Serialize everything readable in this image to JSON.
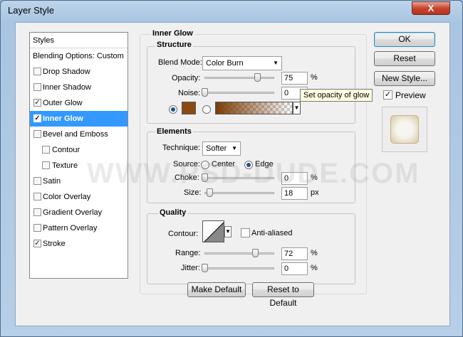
{
  "window": {
    "title": "Layer Style",
    "close_label": "X"
  },
  "styles_list": {
    "items": [
      {
        "label": "Styles",
        "checkbox": false
      },
      {
        "label": "Blending Options: Custom",
        "checkbox": false
      },
      {
        "label": "Drop Shadow",
        "checkbox": true,
        "checked": false
      },
      {
        "label": "Inner Shadow",
        "checkbox": true,
        "checked": false
      },
      {
        "label": "Outer Glow",
        "checkbox": true,
        "checked": true
      },
      {
        "label": "Inner Glow",
        "checkbox": true,
        "checked": true,
        "selected": true
      },
      {
        "label": "Bevel and Emboss",
        "checkbox": true,
        "checked": false
      },
      {
        "label": "Contour",
        "checkbox": true,
        "checked": false,
        "indent": true
      },
      {
        "label": "Texture",
        "checkbox": true,
        "checked": false,
        "indent": true
      },
      {
        "label": "Satin",
        "checkbox": true,
        "checked": false
      },
      {
        "label": "Color Overlay",
        "checkbox": true,
        "checked": false
      },
      {
        "label": "Gradient Overlay",
        "checkbox": true,
        "checked": false
      },
      {
        "label": "Pattern Overlay",
        "checkbox": true,
        "checked": false
      },
      {
        "label": "Stroke",
        "checkbox": true,
        "checked": true
      }
    ]
  },
  "inner_glow": {
    "title": "Inner Glow",
    "structure": {
      "title": "Structure",
      "blend_mode_label": "Blend Mode:",
      "blend_mode_value": "Color Burn",
      "opacity_label": "Opacity:",
      "opacity_value": "75",
      "opacity_unit": "%",
      "noise_label": "Noise:",
      "noise_value": "0",
      "noise_unit": "%",
      "color_swatch": "#8b4a10",
      "gradient_start": "#7a3d08",
      "opacity_level": 0.75,
      "noise_level": 0
    },
    "elements": {
      "title": "Elements",
      "technique_label": "Technique:",
      "technique_value": "Softer",
      "source_label": "Source:",
      "center_label": "Center",
      "edge_label": "Edge",
      "choke_label": "Choke:",
      "choke_value": "0",
      "choke_unit": "%",
      "size_label": "Size:",
      "size_value": "18",
      "size_unit": "px",
      "choke_level": 0,
      "size_level": 0.072
    },
    "quality": {
      "title": "Quality",
      "contour_label": "Contour:",
      "anti_aliased_label": "Anti-aliased",
      "range_label": "Range:",
      "range_value": "72",
      "range_unit": "%",
      "jitter_label": "Jitter:",
      "jitter_value": "0",
      "jitter_unit": "%",
      "range_level": 0.72,
      "jitter_level": 0
    },
    "make_default_label": "Make Default",
    "reset_default_label": "Reset to Default"
  },
  "tooltip": "Set opacity of glow",
  "buttons": {
    "ok_label": "OK",
    "reset_label": "Reset",
    "new_style_label": "New Style...",
    "preview_label": "Preview"
  },
  "watermark": "WWW.PSD-DUDE.COM"
}
